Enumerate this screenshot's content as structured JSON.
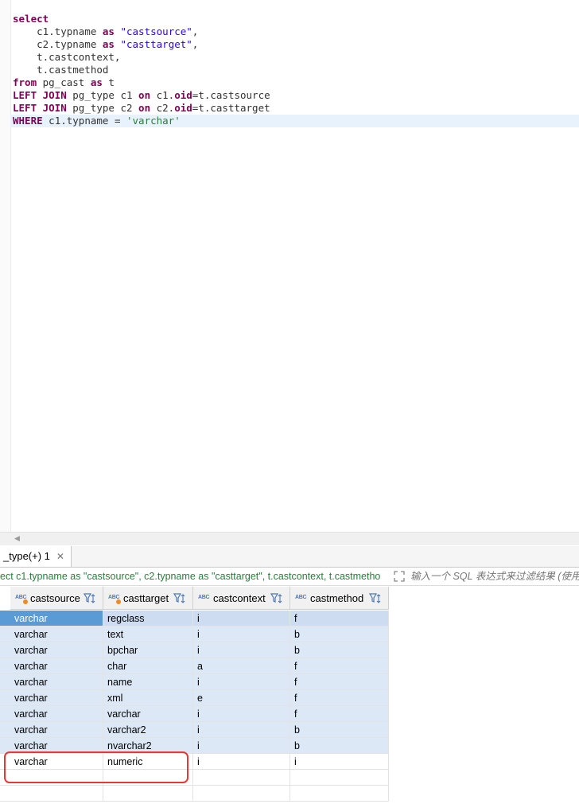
{
  "editor": {
    "lines": [
      [
        {
          "t": "select",
          "c": "kw"
        }
      ],
      [
        {
          "t": "    c1.typname ",
          "c": "ident"
        },
        {
          "t": "as",
          "c": "kw"
        },
        {
          "t": " ",
          "c": "ident"
        },
        {
          "t": "\"castsource\"",
          "c": "str"
        },
        {
          "t": ",",
          "c": "ident"
        }
      ],
      [
        {
          "t": "    c2.typname ",
          "c": "ident"
        },
        {
          "t": "as",
          "c": "kw"
        },
        {
          "t": " ",
          "c": "ident"
        },
        {
          "t": "\"casttarget\"",
          "c": "str"
        },
        {
          "t": ",",
          "c": "ident"
        }
      ],
      [
        {
          "t": "    t.castcontext,",
          "c": "ident"
        }
      ],
      [
        {
          "t": "    t.castmethod",
          "c": "ident"
        }
      ],
      [
        {
          "t": "from",
          "c": "kw"
        },
        {
          "t": " pg_cast ",
          "c": "ident"
        },
        {
          "t": "as",
          "c": "kw"
        },
        {
          "t": " t",
          "c": "ident"
        }
      ],
      [
        {
          "t": "LEFT JOIN",
          "c": "kw"
        },
        {
          "t": " pg_type c1 ",
          "c": "ident"
        },
        {
          "t": "on",
          "c": "kw"
        },
        {
          "t": " c1.",
          "c": "ident"
        },
        {
          "t": "oid",
          "c": "kw"
        },
        {
          "t": "=t.castsource",
          "c": "ident"
        }
      ],
      [
        {
          "t": "LEFT JOIN",
          "c": "kw"
        },
        {
          "t": " pg_type c2 ",
          "c": "ident"
        },
        {
          "t": "on",
          "c": "kw"
        },
        {
          "t": " c2.",
          "c": "ident"
        },
        {
          "t": "oid",
          "c": "kw"
        },
        {
          "t": "=t.casttarget",
          "c": "ident"
        }
      ],
      [
        {
          "t": "WHERE",
          "c": "kw"
        },
        {
          "t": " c1.typname = ",
          "c": "ident"
        },
        {
          "t": "'varchar'",
          "c": "lit"
        }
      ]
    ],
    "current_line": 8
  },
  "result_tab": {
    "label": "_type(+) 1",
    "close_icon": "close-icon"
  },
  "filter_bar": {
    "sql_text": "ect c1.typname as \"castsource\", c2.typname as \"casttarget\", t.castcontext, t.castmetho",
    "placeholder": "输入一个 SQL 表达式来过滤结果 (使用"
  },
  "grid": {
    "columns": [
      {
        "label": "castsource",
        "type_icon": "ABC",
        "key": true
      },
      {
        "label": "casttarget",
        "type_icon": "ABC",
        "key": true
      },
      {
        "label": "castcontext",
        "type_icon": "ABC",
        "key": false
      },
      {
        "label": "castmethod",
        "type_icon": "ABC",
        "key": false
      }
    ],
    "rows": [
      [
        "varchar",
        "regclass",
        "i",
        "f"
      ],
      [
        "varchar",
        "text",
        "i",
        "b"
      ],
      [
        "varchar",
        "bpchar",
        "i",
        "b"
      ],
      [
        "varchar",
        "char",
        "a",
        "f"
      ],
      [
        "varchar",
        "name",
        "i",
        "f"
      ],
      [
        "varchar",
        "xml",
        "e",
        "f"
      ],
      [
        "varchar",
        "varchar",
        "i",
        "f"
      ],
      [
        "varchar",
        "varchar2",
        "i",
        "b"
      ],
      [
        "varchar",
        "nvarchar2",
        "i",
        "b"
      ],
      [
        "varchar",
        "numeric",
        "i",
        "i"
      ]
    ],
    "selected_row": 0,
    "highlighted_row": 9
  },
  "colors": {
    "keyword": "#7f0055",
    "string": "#2a00ff",
    "literal": "#2a7d3a",
    "selection": "#5b9bd5",
    "alt_row": "#dde8f6",
    "highlight_border": "#e53935"
  }
}
